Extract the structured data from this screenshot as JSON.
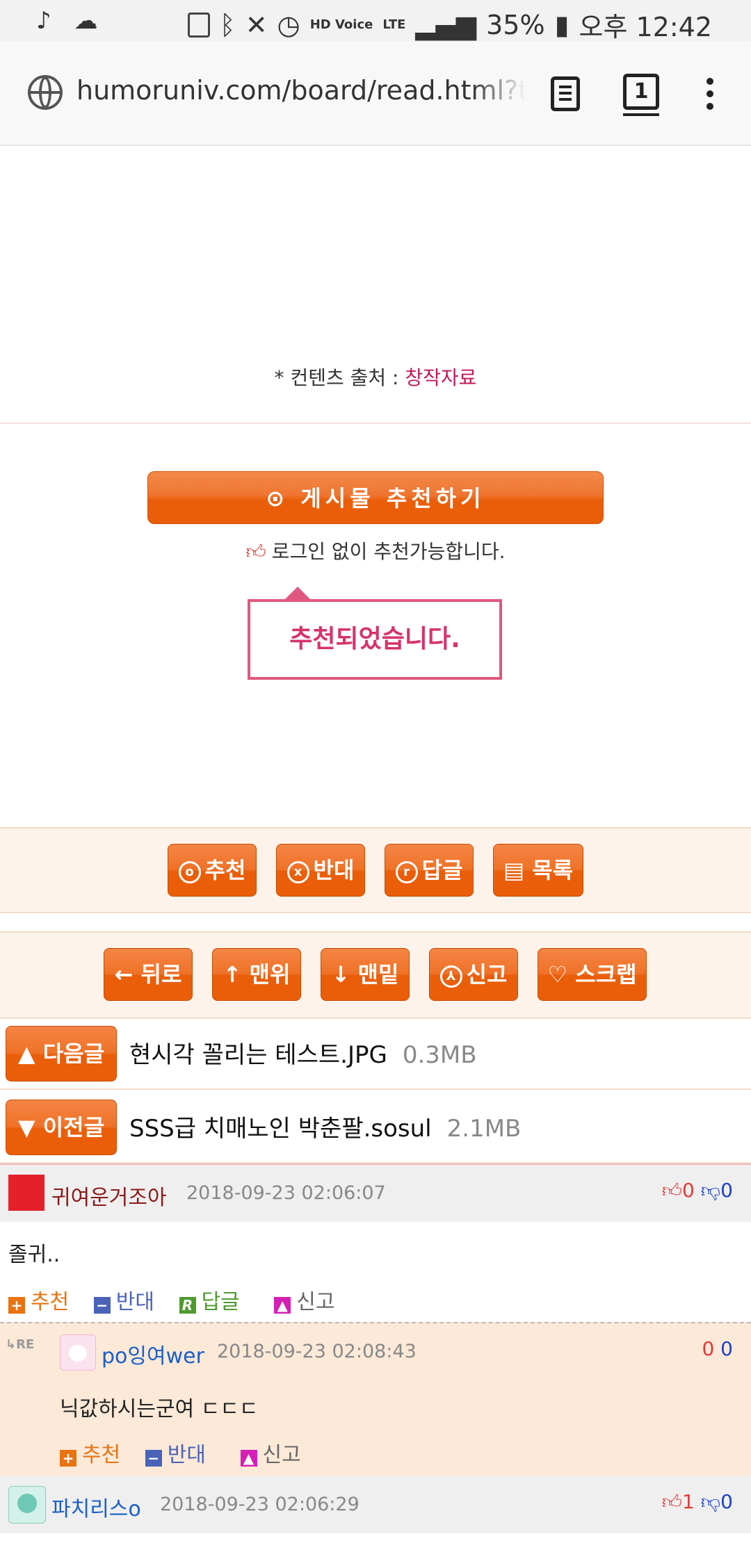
{
  "status_bar": {
    "left_icons": [
      "music-note-icon",
      "cloud-icon"
    ],
    "network": "LTE",
    "hd_voice": "HD Voice",
    "battery": "35%",
    "time": "오후 12:42"
  },
  "browser": {
    "url": "humoruniv.com/board/read.html?table=",
    "tab_count": "1"
  },
  "source": {
    "prefix": "* 컨텐츠 출처 : ",
    "link": "창작자료"
  },
  "recommend": {
    "button": "⊙ 게시물  추천하기",
    "note": "로그인 없이 추천가능합니다.",
    "toast": "추천되었습니다."
  },
  "actions1": {
    "recommend": "추천",
    "oppose": "반대",
    "reply": "답글",
    "list": "목록"
  },
  "actions2": {
    "back": "← 뒤로",
    "top": "↑ 맨위",
    "bottom": "↓ 맨밑",
    "report": "신고",
    "scrap": "♡ 스크랩"
  },
  "next_post": {
    "label": "▲ 다음글",
    "title": "현시각 꼴리는 테스트.JPG",
    "size": "0.3MB"
  },
  "prev_post": {
    "label": "▼ 이전글",
    "title": "SSS급 치매노인 박춘팔.sosul",
    "size": "2.1MB"
  },
  "comments": [
    {
      "author": "귀여운거조아",
      "date": "2018-09-23 02:06:07",
      "up": "0",
      "down": "0",
      "text": "졸귀..",
      "actions": {
        "recommend": "추천",
        "oppose": "반대",
        "reply": "답글",
        "report": "신고"
      }
    },
    {
      "author": "po잉여wer",
      "date": "2018-09-23 02:08:43",
      "up": "0",
      "down": "0",
      "text": "닉값하시는군여 ㄷㄷㄷ",
      "actions": {
        "recommend": "추천",
        "oppose": "반대",
        "report": "신고"
      }
    },
    {
      "author": "파치리스o",
      "date": "2018-09-23 02:06:29",
      "up": "1",
      "down": "0"
    }
  ],
  "colors": {
    "accent_orange": "#ea5e0a",
    "toast_pink": "#d6336c",
    "link_red": "#c2185b",
    "up_red": "#e53935",
    "down_blue": "#1e40c8"
  }
}
